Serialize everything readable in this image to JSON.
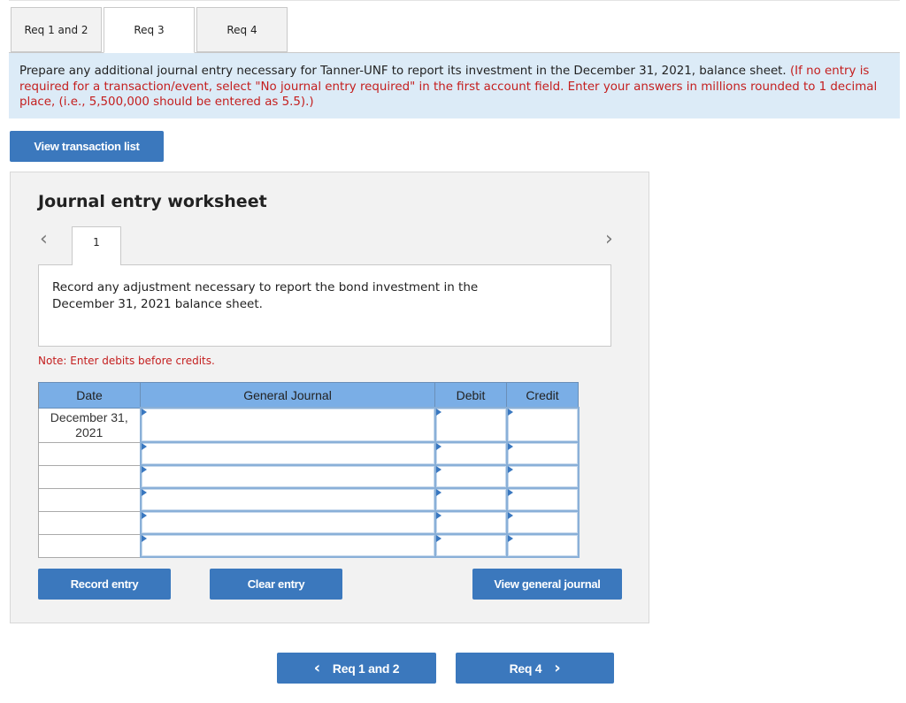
{
  "tabs": [
    {
      "label": "Req 1 and 2",
      "active": false
    },
    {
      "label": "Req 3",
      "active": true
    },
    {
      "label": "Req 4",
      "active": false
    }
  ],
  "instructions": {
    "main": "Prepare any additional journal entry necessary for Tanner-UNF to report its investment in the December 31, 2021, balance sheet. ",
    "note": "(If no entry is required for a transaction/event, select \"No journal entry required\" in the first account field. Enter your answers in millions rounded to 1 decimal place, (i.e., 5,500,000 should be entered as 5.5).)"
  },
  "view_transaction_list_label": "View transaction list",
  "worksheet": {
    "title": "Journal entry worksheet",
    "entry_number": "1",
    "prev_icon": "‹",
    "next_icon": "›",
    "description": "Record any adjustment necessary to report the bond investment in the December 31, 2021 balance sheet.",
    "note": "Note: Enter debits before credits.",
    "table": {
      "headers": {
        "date": "Date",
        "general_journal": "General Journal",
        "debit": "Debit",
        "credit": "Credit"
      },
      "rows": [
        {
          "date": "December 31, 2021",
          "account": "",
          "debit": "",
          "credit": ""
        },
        {
          "date": "",
          "account": "",
          "debit": "",
          "credit": ""
        },
        {
          "date": "",
          "account": "",
          "debit": "",
          "credit": ""
        },
        {
          "date": "",
          "account": "",
          "debit": "",
          "credit": ""
        },
        {
          "date": "",
          "account": "",
          "debit": "",
          "credit": ""
        },
        {
          "date": "",
          "account": "",
          "debit": "",
          "credit": ""
        }
      ]
    },
    "buttons": {
      "record": "Record entry",
      "clear": "Clear entry",
      "view_journal": "View general journal"
    }
  },
  "nav": {
    "prev_label": "Req 1 and 2",
    "next_label": "Req 4",
    "prev_icon": "‹",
    "next_icon": "›"
  },
  "colors": {
    "button_blue": "#3b78bd",
    "instruction_bg": "#dcebf7",
    "note_red": "#c41e1e",
    "table_header_blue": "#7aaee6"
  }
}
